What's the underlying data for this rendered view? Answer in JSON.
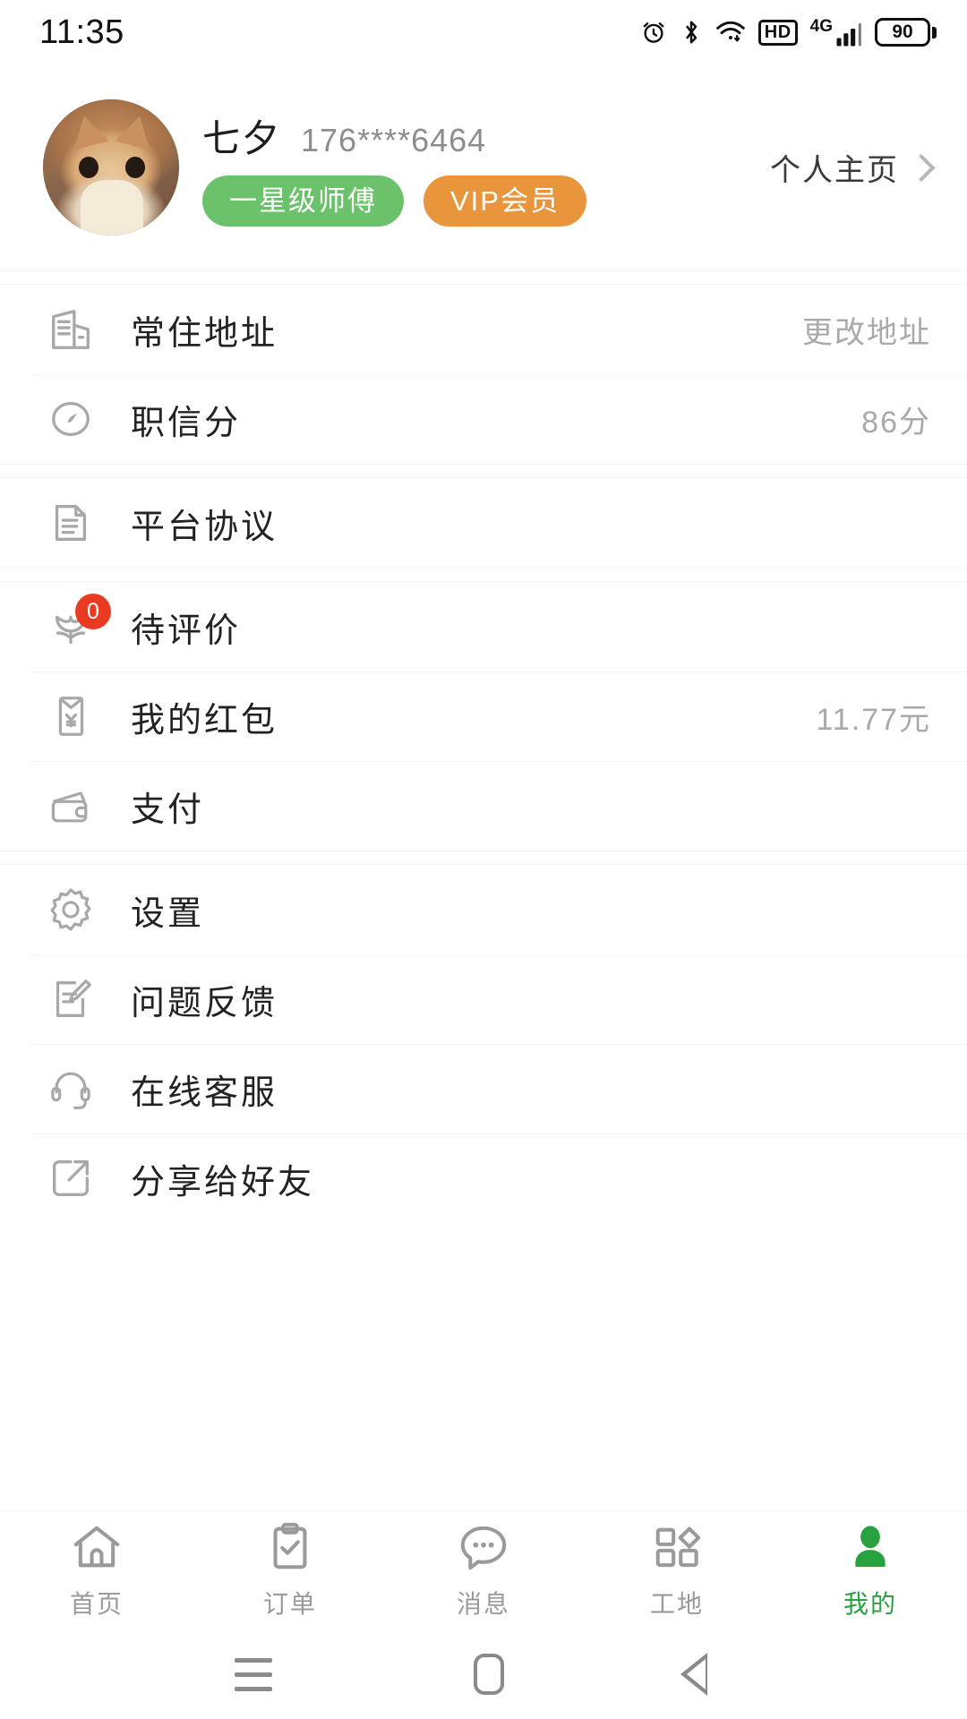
{
  "status_bar": {
    "time": "11:35",
    "hd_label": "HD",
    "network_label": "4G",
    "battery_level": "90",
    "icons": [
      "alarm-icon",
      "bluetooth-icon",
      "wifi-icon",
      "hd-icon",
      "signal-icon",
      "battery-icon"
    ]
  },
  "profile": {
    "avatar_alt": "cat-avatar",
    "name": "七夕",
    "phone": "176****6464",
    "badges": [
      {
        "label": "一星级师傅",
        "color": "#6cc16b"
      },
      {
        "label": "VIP会员",
        "color": "#e8953c"
      }
    ],
    "home_link_label": "个人主页"
  },
  "groups": [
    {
      "items": [
        {
          "icon": "building-icon",
          "label": "常住地址",
          "value": "更改地址"
        },
        {
          "icon": "gauge-icon",
          "label": "职信分",
          "value": "86分"
        }
      ]
    },
    {
      "items": [
        {
          "icon": "document-icon",
          "label": "平台协议",
          "value": ""
        }
      ]
    },
    {
      "items": [
        {
          "icon": "flower-icon",
          "label": "待评价",
          "value": "",
          "badge": "0"
        },
        {
          "icon": "red-packet-icon",
          "label": "我的红包",
          "value": "11.77元"
        },
        {
          "icon": "wallet-icon",
          "label": "支付",
          "value": ""
        }
      ]
    },
    {
      "items": [
        {
          "icon": "gear-icon",
          "label": "设置",
          "value": ""
        },
        {
          "icon": "feedback-icon",
          "label": "问题反馈",
          "value": ""
        },
        {
          "icon": "headset-icon",
          "label": "在线客服",
          "value": ""
        },
        {
          "icon": "share-icon",
          "label": "分享给好友",
          "value": ""
        }
      ]
    }
  ],
  "tabbar": {
    "active_color": "#27a23f",
    "tabs": [
      {
        "icon": "home-icon",
        "label": "首页",
        "active": false
      },
      {
        "icon": "clipboard-icon",
        "label": "订单",
        "active": false
      },
      {
        "icon": "chat-icon",
        "label": "消息",
        "active": false
      },
      {
        "icon": "grid-icon",
        "label": "工地",
        "active": false
      },
      {
        "icon": "person-icon",
        "label": "我的",
        "active": true
      }
    ]
  },
  "android_nav": {
    "recents": "recents-icon",
    "home": "home-square-icon",
    "back": "back-triangle-icon"
  }
}
